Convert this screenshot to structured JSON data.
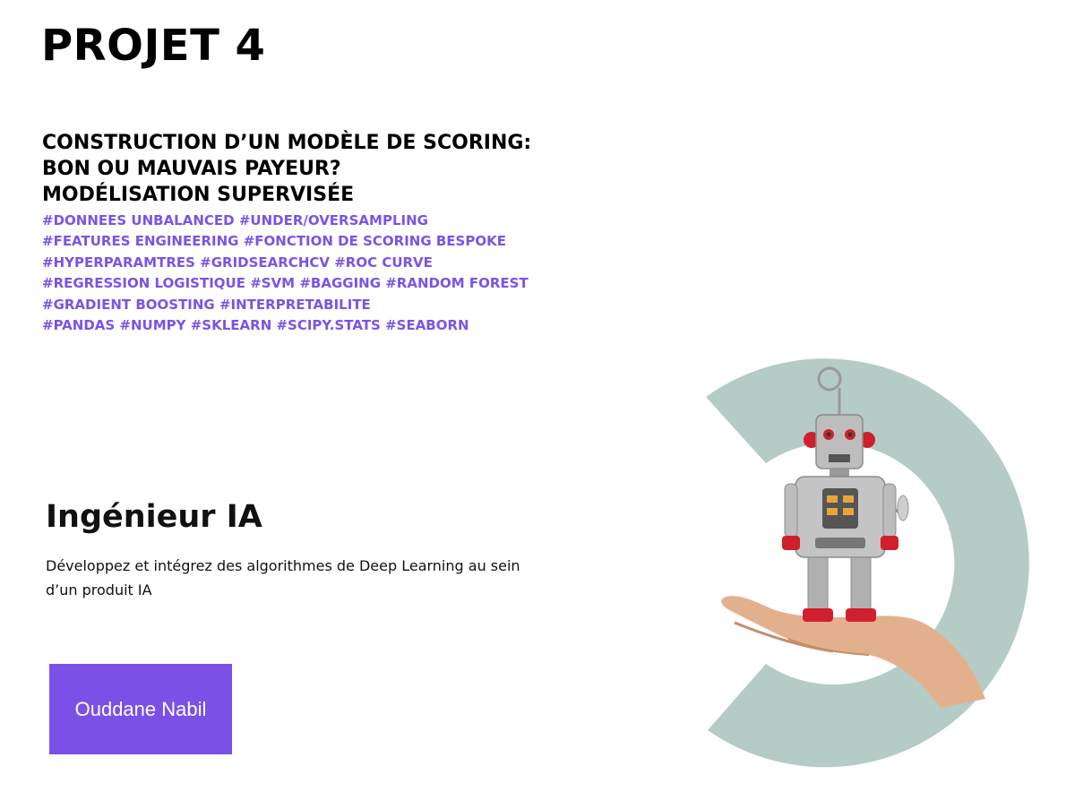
{
  "header": {
    "title": "PROJET 4"
  },
  "subtitle": {
    "lines": [
      "CONSTRUCTION D’UN MODÈLE DE SCORING:",
      "BON OU MAUVAIS PAYEUR?",
      "MODÉLISATION SUPERVISÉE"
    ]
  },
  "tags": {
    "lines": [
      "#DONNEES UNBALANCED #UNDER/OVERSAMPLING",
      "#FEATURES ENGINEERING #FONCTION DE SCORING BESPOKE",
      "#HYPERPARAMTRES #GRIDSEARCHCV #ROC CURVE",
      "#REGRESSION LOGISTIQUE #SVM #BAGGING #RANDOM FOREST",
      "#GRADIENT BOOSTING #INTERPRETABILITE",
      "#PANDAS #NUMPY #SKLEARN #SCIPY.STATS #SEABORN"
    ]
  },
  "role": {
    "title": "Ingénieur IA",
    "description": "Développez et intégrez des algorithmes de Deep Learning au sein d’un produit IA"
  },
  "author": {
    "button_label": "Ouddane Nabil"
  },
  "colors": {
    "accent": "#7b50e7",
    "tag_text": "#7b53e6",
    "arc": "#b4cbc6",
    "robot_body": "#b7b7b7",
    "robot_red": "#d0202e",
    "skin": "#e3b08e"
  },
  "illustration": {
    "icon": "robot-on-hand-icon"
  }
}
